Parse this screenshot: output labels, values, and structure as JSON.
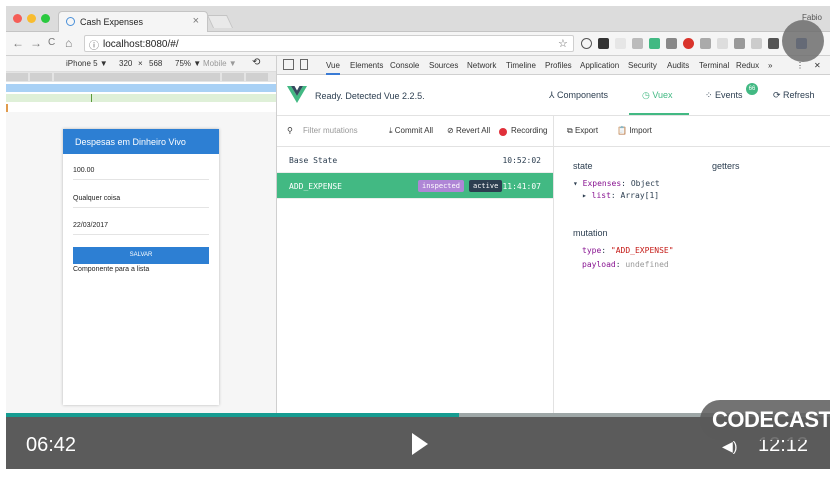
{
  "browser": {
    "tab_title": "Cash Expenses",
    "tab_close": "×",
    "user": "Fabio",
    "url": "localhost:8080/#/",
    "back": "←",
    "forward": "→",
    "reload": "C",
    "home": "⌂",
    "info": "ⓘ",
    "bookmark": "☆"
  },
  "device_toolbar": {
    "device": "iPhone 5 ▼",
    "width": "320",
    "times": "×",
    "height": "568",
    "zoom": "75% ▼",
    "mode": "Mobile ▼",
    "rotate": "⟲"
  },
  "app": {
    "title": "Despesas em Dinheiro Vivo",
    "fields": [
      "100.00",
      "Qualquer coisa",
      "22/03/2017"
    ],
    "save_label": "SALVAR",
    "list_note": "Componente para a lista"
  },
  "devtools": {
    "tabs": [
      "Vue",
      "Elements",
      "Console",
      "Sources",
      "Network",
      "Timeline",
      "Profiles",
      "Application",
      "Security",
      "Audits",
      "Terminal",
      "Redux",
      "»"
    ],
    "active_tab": "Vue",
    "menu": "⋮",
    "close": "✕"
  },
  "vue": {
    "ready": "Ready. Detected Vue 2.2.5.",
    "nav": {
      "components": "Components",
      "vuex": "Vuex",
      "events": "Events",
      "events_count": "66",
      "refresh": "Refresh"
    },
    "toolbar": {
      "filter_placeholder": "Filter mutations",
      "commit_all": "Commit All",
      "revert_all": "Revert All",
      "recording": "Recording",
      "export": "Export",
      "import": "Import"
    },
    "mutations": [
      {
        "name": "Base State",
        "time": "10:52:02"
      },
      {
        "name": "ADD_EXPENSE",
        "time": "11:41:07",
        "tags": [
          "inspected",
          "active"
        ]
      }
    ],
    "state": {
      "state_heading": "state",
      "getters_heading": "getters",
      "expenses_key": "Expenses",
      "expenses_value": "Object",
      "list_key": "list",
      "list_value": "Array[1]",
      "mutation_heading": "mutation",
      "type_key": "type",
      "type_value": "\"ADD_EXPENSE\"",
      "payload_key": "payload",
      "payload_value": "undefined"
    }
  },
  "player": {
    "elapsed": "06:42",
    "duration": "12:12",
    "progress": 0.55,
    "watermark": "CODECASTS"
  },
  "colors": {
    "vue_green": "#42b983",
    "app_blue": "#2d7fd3",
    "progress_teal": "#169c91",
    "controls_gray": "#5b5b5b"
  }
}
